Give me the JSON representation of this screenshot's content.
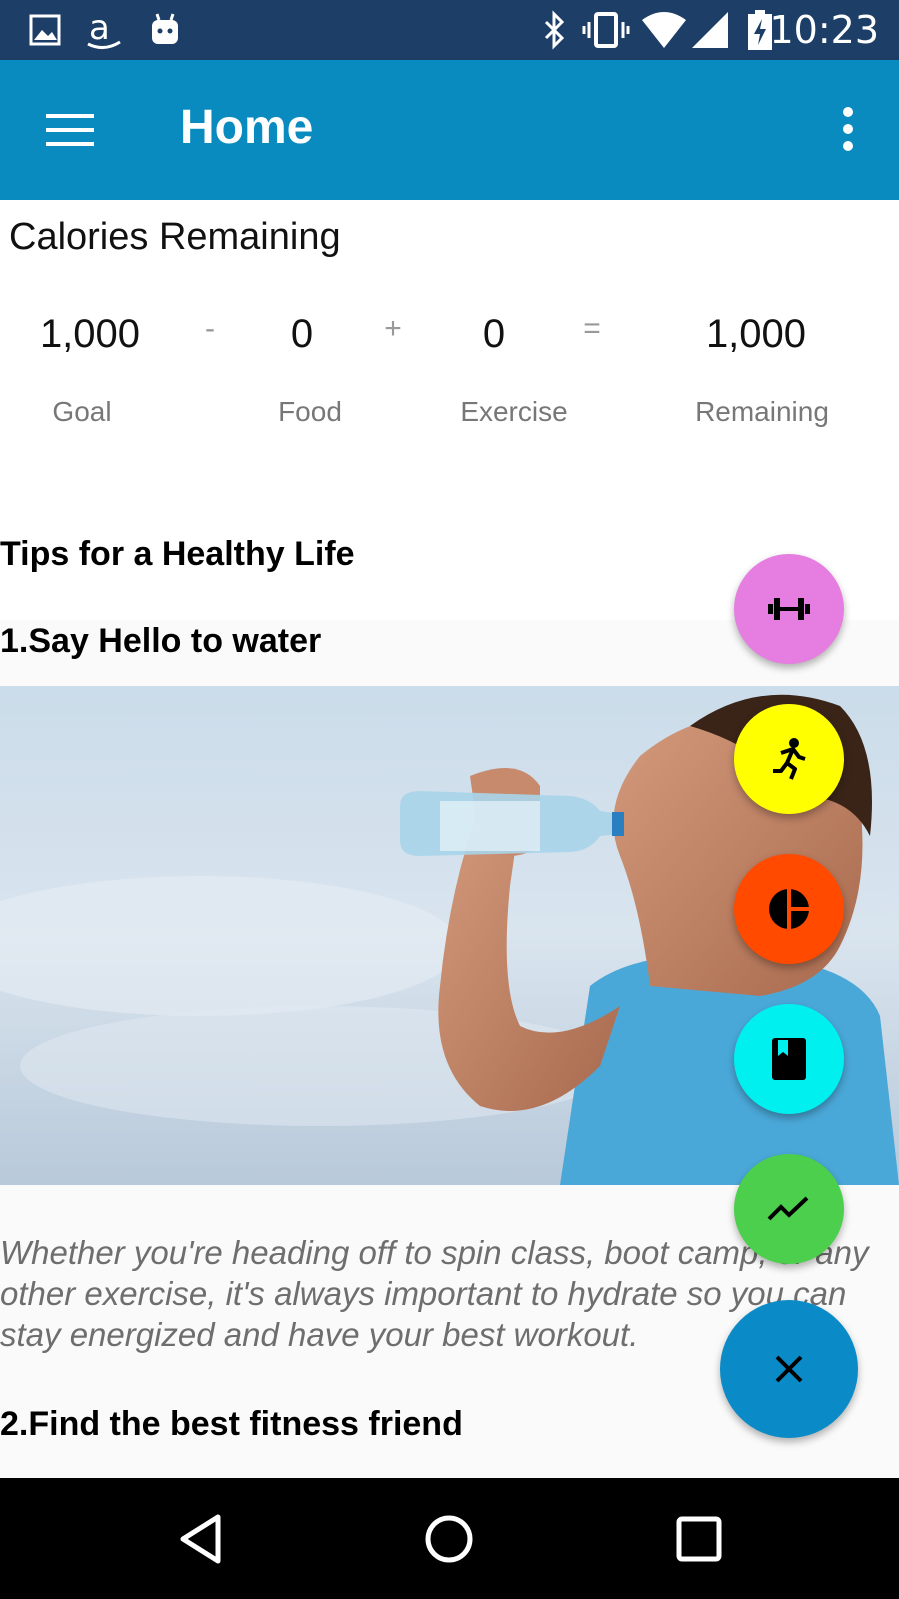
{
  "status_bar": {
    "time": "10:23",
    "left_icons": [
      "gallery-icon",
      "amazon-icon",
      "android-icon"
    ],
    "right_icons": [
      "bluetooth-icon",
      "vibrate-icon",
      "wifi-icon",
      "signal-icon",
      "battery-charging-icon"
    ]
  },
  "app_bar": {
    "title": "Home",
    "background": "#0a8bbf"
  },
  "calories": {
    "heading": "Calories Remaining",
    "goal_value": "1,000",
    "minus": "-",
    "food_value": "0",
    "plus": "+",
    "exercise_value": "0",
    "equals": "=",
    "remaining_value": "1,000",
    "goal_label": "Goal",
    "food_label": "Food",
    "exercise_label": "Exercise",
    "remaining_label": "Remaining"
  },
  "tips": {
    "title": "Tips for a Healthy Life",
    "tip1_title": "1.Say Hello to water",
    "tip1_text": "Whether you're heading off to spin class, boot camp, or any other exercise, it's always important to hydrate so you can stay energized and have your best workout.",
    "tip2_title": "2.Find the best fitness friend"
  },
  "fab_menu": [
    {
      "icon": "dumbbell-icon",
      "color": "#e57ee0"
    },
    {
      "icon": "running-icon",
      "color": "#ffff00"
    },
    {
      "icon": "pie-chart-icon",
      "color": "#ff4a00"
    },
    {
      "icon": "diary-icon",
      "color": "#00f0f0"
    },
    {
      "icon": "trending-icon",
      "color": "#4ccf4c"
    },
    {
      "icon": "close-icon",
      "color": "#0a8bc7"
    }
  ],
  "nav_bar": {
    "buttons": [
      "back-icon",
      "home-icon",
      "recents-icon"
    ]
  }
}
